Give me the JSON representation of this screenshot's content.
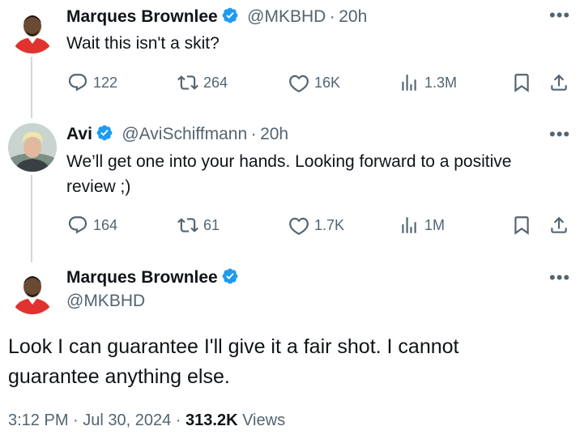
{
  "tweets": [
    {
      "name": "Marques Brownlee",
      "handle": "@MKBHD",
      "time": "20h",
      "text": "Wait this isn't a skit?",
      "replies": "122",
      "reposts": "264",
      "likes": "16K",
      "views": "1.3M"
    },
    {
      "name": "Avi",
      "handle": "@AviSchiffmann",
      "time": "20h",
      "text_line1": "We’ll get one into your hands. Looking forward to a positive",
      "text_line2": "review ;)",
      "replies": "164",
      "reposts": "61",
      "likes": "1.7K",
      "views": "1M"
    }
  ],
  "main_tweet": {
    "name": "Marques Brownlee",
    "handle": "@MKBHD",
    "text_line1": "Look I can guarantee I'll give it a fair shot. I cannot",
    "text_line2": "guarantee anything else.",
    "timestamp": "3:12 PM · Jul 30, 2024 ·",
    "views_count": "313.2K",
    "views_label": "Views"
  },
  "separator": "·",
  "more_glyph": "•••",
  "icons": [
    "verified-badge-icon",
    "reply-icon",
    "repost-icon",
    "like-icon",
    "views-icon",
    "bookmark-icon",
    "share-icon",
    "more-icon"
  ],
  "colors": {
    "verified": "#1d9bf0",
    "muted": "#536471",
    "text": "#0f1419",
    "thread_line": "#cfd9de"
  }
}
